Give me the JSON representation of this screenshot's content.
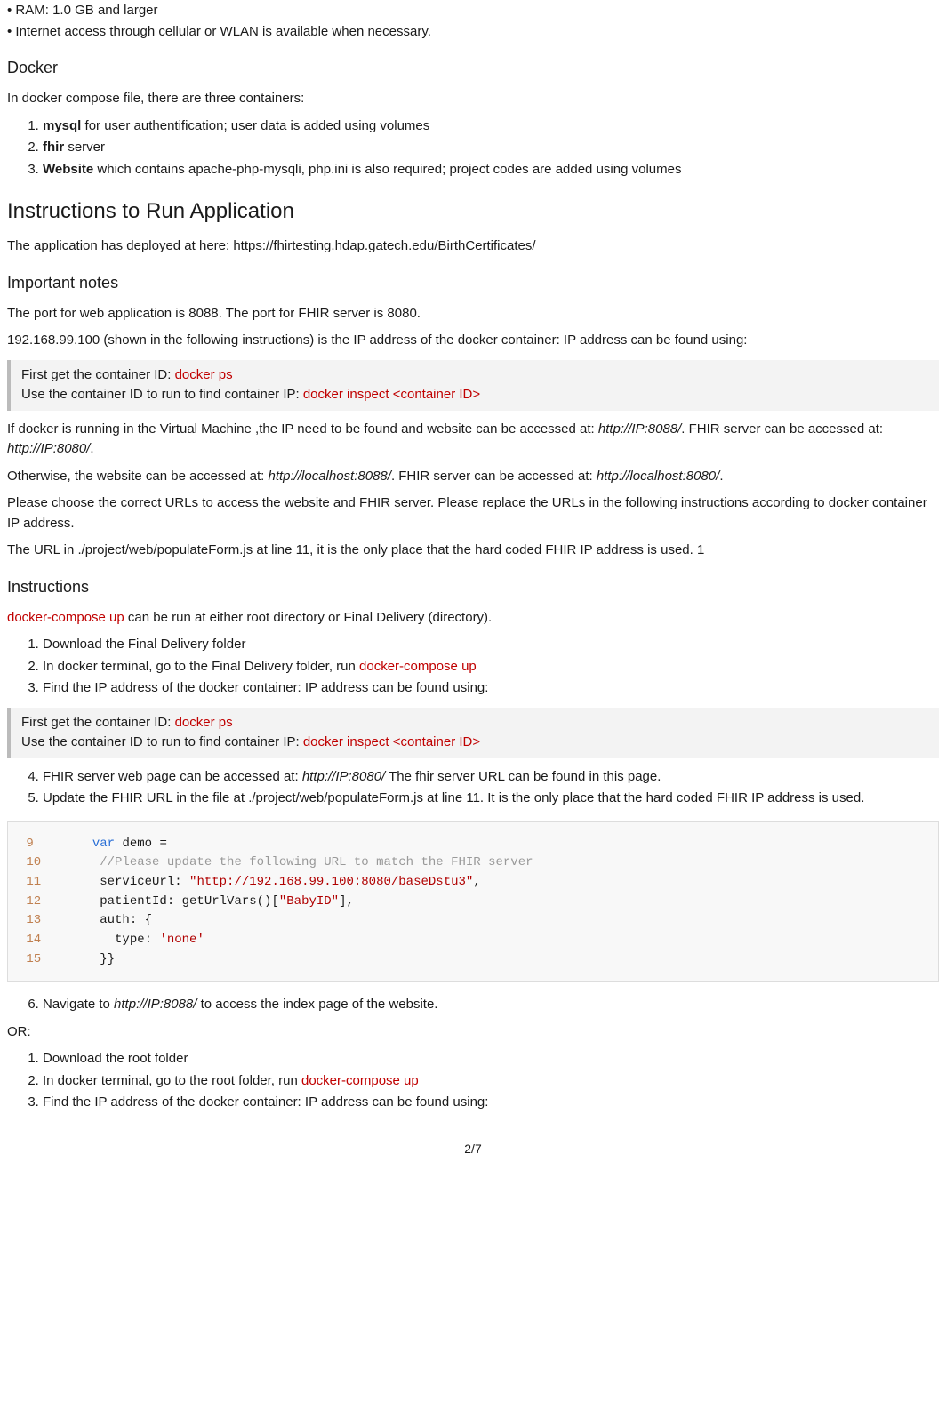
{
  "top_bullets": [
    "RAM: 1.0 GB and larger",
    "Internet access through cellular or WLAN is available when necessary."
  ],
  "docker": {
    "heading": "Docker",
    "intro": "In docker compose file, there are three containers:",
    "items": [
      {
        "bold": "mysql",
        "rest": " for user authentification; user data is added using volumes"
      },
      {
        "bold": "fhir",
        "rest": " server"
      },
      {
        "bold": "Website",
        "rest": " which contains apache-php-mysqli, php.ini is also required; project codes are added using volumes"
      }
    ]
  },
  "run_app": {
    "heading": "Instructions to Run Application",
    "deploy_line_prefix": "The application has deployed at here: ",
    "deploy_url": "https://fhirtesting.hdap.gatech.edu/BirthCertificates/"
  },
  "notes": {
    "heading": "Important notes",
    "p1": "The port for web application is 8088. The port for FHIR server is 8080.",
    "p2": "192.168.99.100 (shown in the following instructions) is the IP address of the docker container: IP address can be found using:",
    "bq_l1_a": "First get the container ID: ",
    "bq_l1_b": "docker ps",
    "bq_l2_a": "Use the container ID to run to find container IP: ",
    "bq_l2_b": "docker inspect <container ID>",
    "p3_a": "If docker is running in the Virtual Machine ,the IP need to be found and website can be accessed at: ",
    "p3_em1": "http://IP:8088/",
    "p3_b": ". FHIR server can be accessed at: ",
    "p3_em2": "http://IP:8080/",
    "p3_c": ".",
    "p4_a": "Otherwise, the website can be accessed at: ",
    "p4_em1": "http://localhost:8088/",
    "p4_b": ". FHIR server can be accessed at: ",
    "p4_em2": "http://localhost:8080/",
    "p4_c": ".",
    "p5": "Please choose the correct URLs to access the website and FHIR server. Please replace the URLs in the following instructions according to docker container IP address.",
    "p6": "The URL in ./project/web/populateForm.js at line 11, it is the only place that the hard coded FHIR IP address is used. 1"
  },
  "instr": {
    "heading": "Instructions",
    "intro_cmd": "docker-compose up",
    "intro_rest": " can be run at either root directory or Final Delivery (directory).",
    "ol1_1": "Download the Final Delivery folder",
    "ol1_2a": "In docker terminal, go to the Final Delivery folder, run ",
    "ol1_2b": "docker-compose up",
    "ol1_3": "Find the IP address of the docker container: IP address can be found using:",
    "ol1_4a": "FHIR server web page can be accessed at: ",
    "ol1_4em": "http://IP:8080/",
    "ol1_4b": " The fhir server URL can be found in this page.",
    "ol1_5": "Update the FHIR URL in the file at ./project/web/populateForm.js at line 11. It is the only place that the hard coded FHIR IP address is used.",
    "ol1_6a": "Navigate to ",
    "ol1_6em": "http://IP:8088/",
    "ol1_6b": " to access the index page of the website.",
    "or": "OR:",
    "ol2_1": "Download the root folder",
    "ol2_2a": "In docker terminal, go to the root folder, run ",
    "ol2_2b": "docker-compose up",
    "ol2_3": "Find the IP address of the docker container: IP address can be found using:"
  },
  "code": {
    "l9_ln": "9",
    "l9_kw": "var",
    "l9_rest": " demo =",
    "l10_ln": "10",
    "l10_cmt": "//Please update the following URL to match the FHIR server",
    "l11_ln": "11",
    "l11_a": "serviceUrl: ",
    "l11_str": "\"http://192.168.99.100:8080/baseDstu3\"",
    "l11_b": ",",
    "l12_ln": "12",
    "l12_a": "patientId: getUrlVars()[",
    "l12_str": "\"BabyID\"",
    "l12_b": "],",
    "l13_ln": "13",
    "l13_a": "auth: {",
    "l14_ln": "14",
    "l14_a": "  type: ",
    "l14_str": "'none'",
    "l15_ln": "15",
    "l15_a": "}}"
  },
  "page_num": "2/7"
}
